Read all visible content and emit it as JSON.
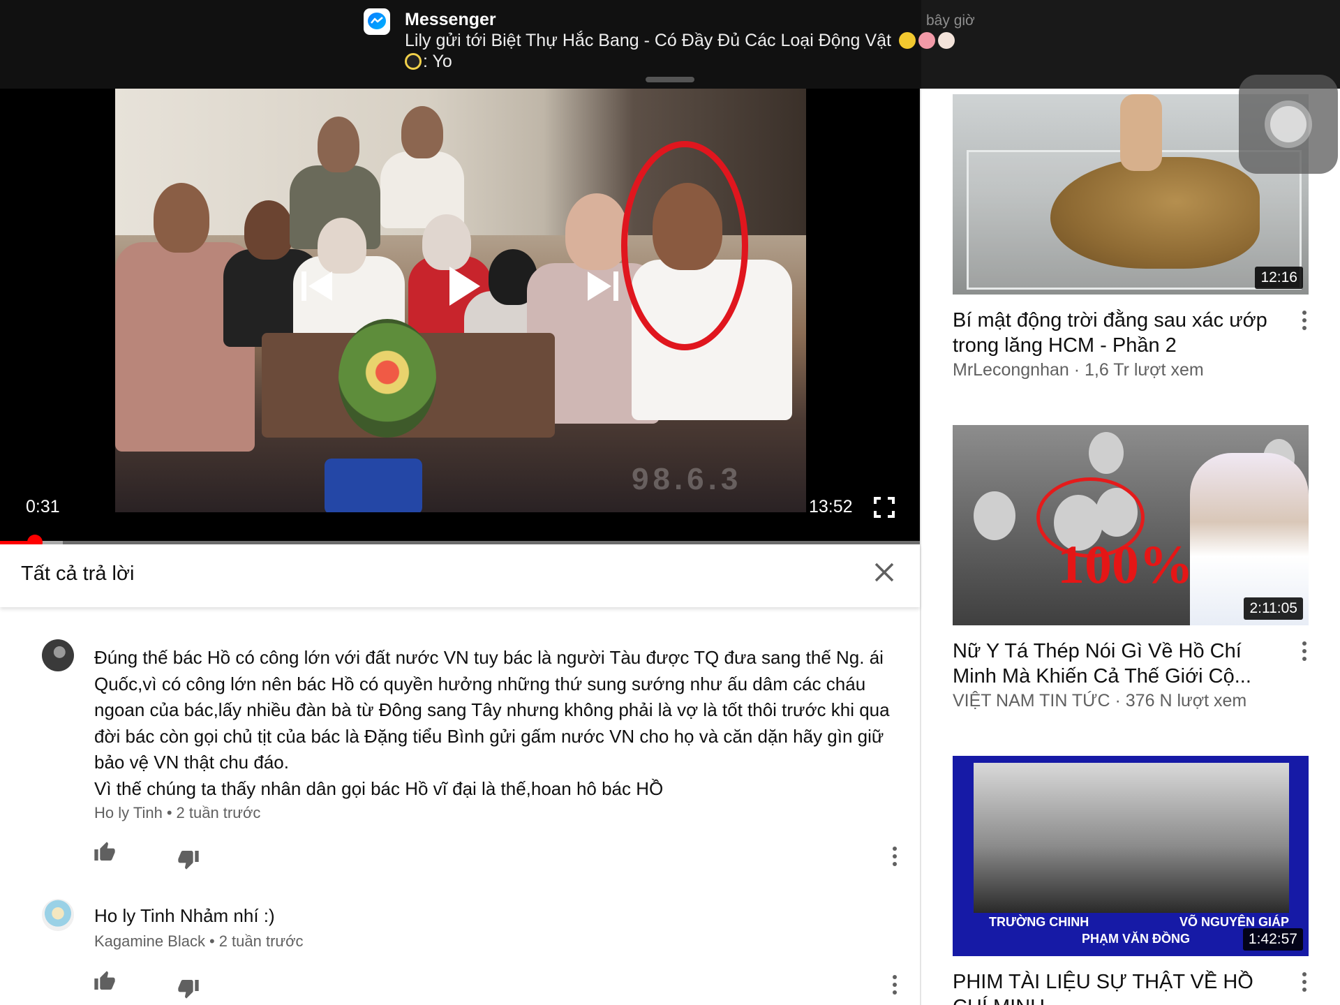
{
  "notification": {
    "app_name": "Messenger",
    "time": "bây giờ",
    "line1": "Lily gửi tới Biệt Thự Hắc Bang - Có Đầy Đủ Các Loại Động Vật",
    "line2": ": Yo",
    "icon": "messenger-icon"
  },
  "player": {
    "time_current": "0:31",
    "time_total": "13:52",
    "progress_played": 0.038,
    "progress_buffered": 0.068,
    "video_watermark": "98.6.3",
    "controls": [
      "previous-icon",
      "play-icon",
      "next-icon",
      "fullscreen-icon"
    ]
  },
  "replies": {
    "title": "Tất cả trả lời",
    "close_icon": "close-icon",
    "comments": [
      {
        "text_lines": [
          "Đúng thế bác Hồ có công lớn với đất nước VN tuy bác là người Tàu được TQ đưa sang thế Ng. ái",
          "Quốc,vì có công lớn nên bác Hồ có quyền hưởng những thứ sung sướng như ấu dâm các cháu",
          "ngoan của bác,lấy nhiều đàn bà từ Đông sang Tây nhưng không phải là vợ là tốt thôi trước khi qua",
          "đời bác còn gọi chủ tịt của bác là Đặng tiểu Bình gửi gấm nước VN cho họ và căn dặn hãy gìn giữ",
          "bảo vệ VN thật chu đáo.",
          "Vì thế chúng ta thấy nhân dân gọi bác Hồ vĩ đại là thế,hoan hô bác HỒ"
        ],
        "author": "Ho ly Tinh",
        "time": "2 tuần trước"
      },
      {
        "text_lines": [
          "Ho ly Tinh Nhảm nhí :)"
        ],
        "author": "Kagamine Black",
        "time": "2 tuần trước"
      }
    ]
  },
  "sidebar": {
    "videos": [
      {
        "duration": "12:16",
        "title": "Bí mật động trời đằng sau xác ướp trong lăng HCM - Phần 2",
        "channel": "MrLecongnhan",
        "views": "1,6 Tr lượt xem"
      },
      {
        "duration": "2:11:05",
        "title": "Nữ Y Tá Thép Nói Gì Về Hồ Chí Minh Mà Khiến Cả Thế Giới Cộ...",
        "channel": "VIỆT NAM TIN TỨC",
        "views": "376 N lượt xem",
        "thumb_text": "100%"
      },
      {
        "duration": "1:42:57",
        "title": "PHIM TÀI LIỆU SỰ THẬT VỀ HỒ CHÍ MINH",
        "channel": "",
        "views": "",
        "thumb_labels": [
          "TRƯỜNG CHINH",
          "PHẠM VĂN ĐỒNG",
          "VÕ NGUYÊN GIÁP"
        ]
      }
    ]
  },
  "colors": {
    "progress_red": "#ff0000",
    "circle_red": "#e0161e",
    "meta_gray": "#606060"
  }
}
